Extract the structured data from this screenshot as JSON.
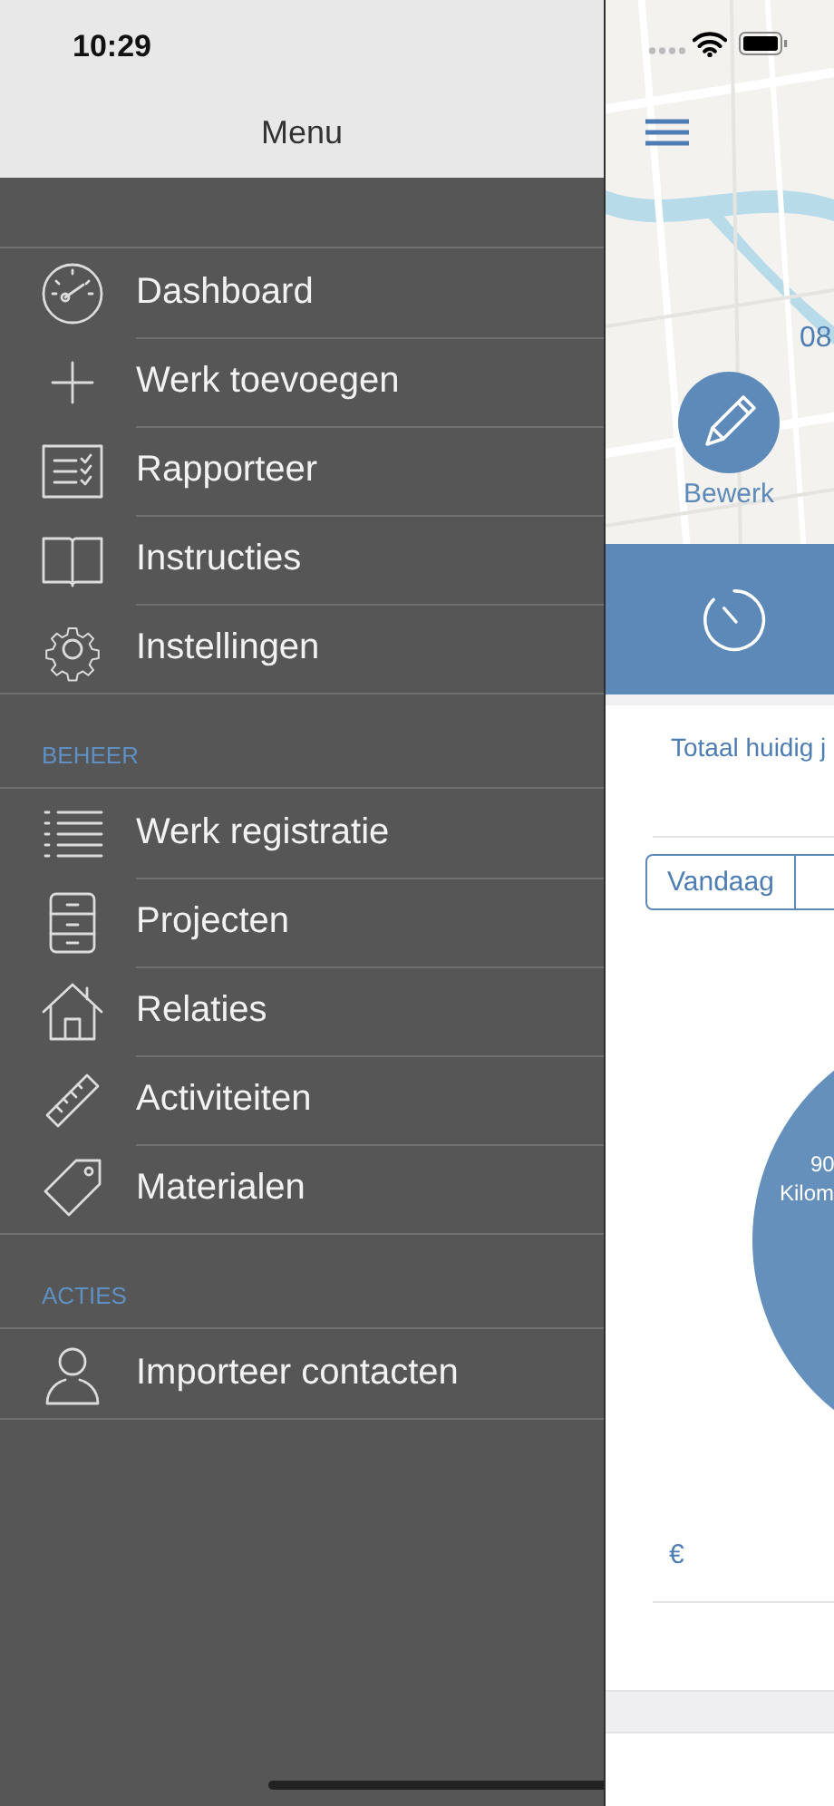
{
  "status_bar": {
    "time": "10:29"
  },
  "menu": {
    "title": "Menu",
    "sections": [
      {
        "items": [
          "Dashboard",
          "Werk toevoegen",
          "Rapporteer",
          "Instructies",
          "Instellingen"
        ]
      },
      {
        "heading": "BEHEER",
        "items": [
          "Werk registratie",
          "Projecten",
          "Relaties",
          "Activiteiten",
          "Materialen"
        ]
      },
      {
        "heading": "ACTIES",
        "items": [
          "Importeer contacten"
        ]
      }
    ]
  },
  "main": {
    "map_label": "08",
    "edit_button": "Bewerk",
    "summary_title": "Totaal huidig j",
    "segment": "Vandaag",
    "pie_labels": [
      "90",
      "Kilom"
    ],
    "currency": "€"
  }
}
